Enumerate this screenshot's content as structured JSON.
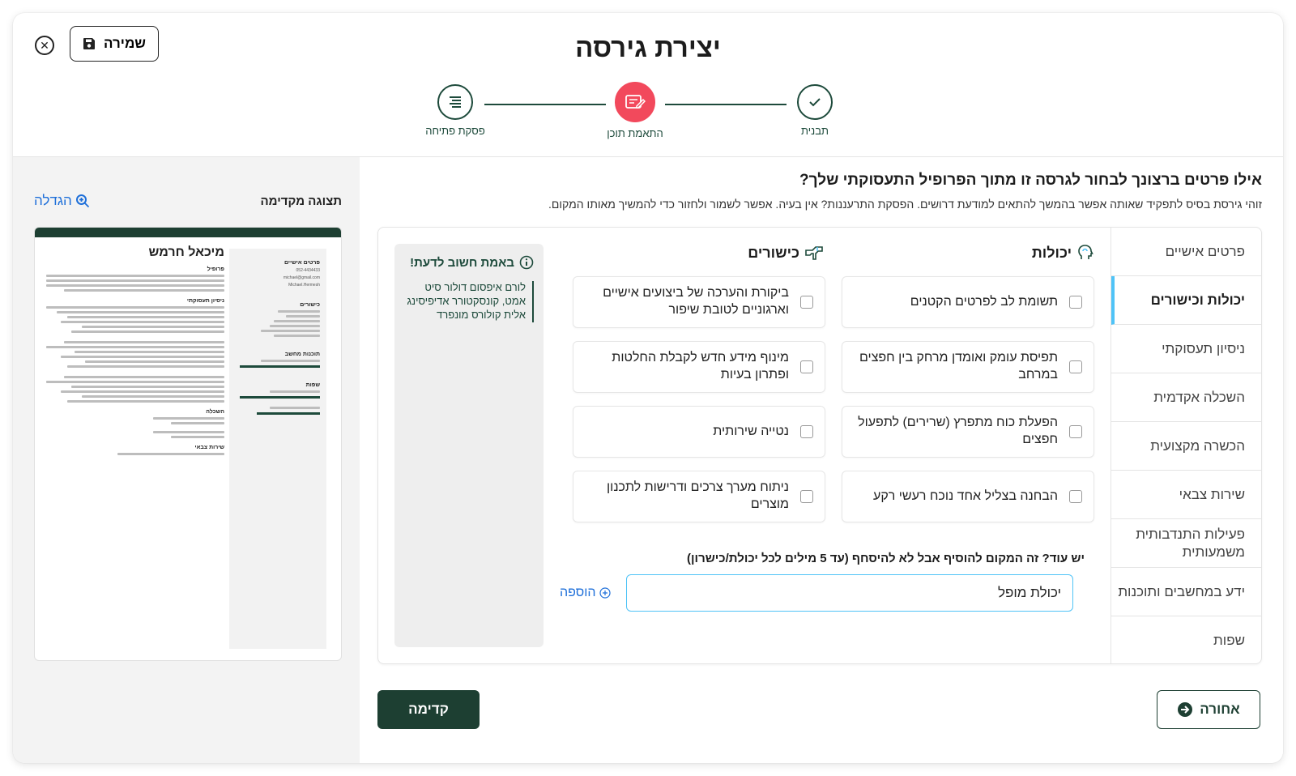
{
  "header": {
    "title": "יצירת גירסה",
    "save_label": "שמירה"
  },
  "stepper": {
    "steps": [
      {
        "label": "תבנית",
        "state": "done"
      },
      {
        "label": "התאמת תוכן",
        "state": "active"
      },
      {
        "label": "פסקת פתיחה",
        "state": "pending"
      }
    ]
  },
  "preview": {
    "title": "תצוגה מקדימה",
    "zoom_label": "הגדלה",
    "resume": {
      "name": "מיכאל חרמש",
      "sections": [
        "פרופיל",
        "ניסיון תעסוקתי",
        "השכלה",
        "שירות צבאי"
      ],
      "side_sections": [
        "פרטים אישיים",
        "כישורים",
        "תוכנות מחשב",
        "שפות"
      ],
      "contact": [
        "052-4434433",
        "michael@gmail.com",
        "Michael.Hermesh"
      ]
    }
  },
  "main": {
    "question": "אילו פרטים ברצונך לבחור לגרסה זו מתוך הפרופיל התעסוקתי שלך?",
    "subtitle": "זוהי גירסת בסיס לתפקיד שאותה אפשר בהמשך להתאים למודעת דרושים. הפסקת התרעננות? אין בעיה. אפשר לשמור ולחזור כדי להמשיך מאותו המקום."
  },
  "side_nav": [
    {
      "label": "פרטים אישיים",
      "active": false
    },
    {
      "label": "יכולות וכישורים",
      "active": true
    },
    {
      "label": "ניסיון תעסוקתי",
      "active": false
    },
    {
      "label": "השכלה אקדמית",
      "active": false
    },
    {
      "label": "הכשרה מקצועית",
      "active": false
    },
    {
      "label": "שירות צבאי",
      "active": false
    },
    {
      "label": "פעילות התנדבותית משמעותית",
      "active": false
    },
    {
      "label": "ידע במחשבים ותוכנות",
      "active": false
    },
    {
      "label": "שפות",
      "active": false
    }
  ],
  "abilities": {
    "heading": "יכולות",
    "items": [
      "תשומת לב לפרטים הקטנים",
      "תפיסת עומק ואומדן מרחק בין חפצים במרחב",
      "הפעלת כוח מתפרץ (שרירים) לתפעול חפצים",
      "הבחנה בצליל אחד נוכח רעשי רקע"
    ]
  },
  "skills": {
    "heading": "כישורים",
    "items": [
      "ביקורת והערכה של ביצועים אישיים וארגוניים לטובת שיפור",
      "מינוף מידע חדש לקבלת החלטות ופתרון בעיות",
      "נטייה שירותית",
      "ניתוח מערך צרכים ודרישות לתכנון מוצרים"
    ]
  },
  "tip": {
    "heading": "באמת חשוב לדעת!",
    "body": "לורם איפסום דולור סיט אמט, קונסקטורר אדיפיסינג אלית קולורס מונפרד"
  },
  "more": {
    "label": "יש עוד? זה המקום להוסיף אבל לא להיסחף (עד 5 מילים לכל יכולת/כישרון)",
    "value": "יכולת מופל",
    "add_label": "הוספה"
  },
  "footer": {
    "next_label": "קדימה",
    "back_label": "אחורה"
  },
  "colors": {
    "primary": "#1d3f32",
    "accent": "#f2495c",
    "link": "#1e6fd9",
    "highlight": "#4fc3f7"
  }
}
